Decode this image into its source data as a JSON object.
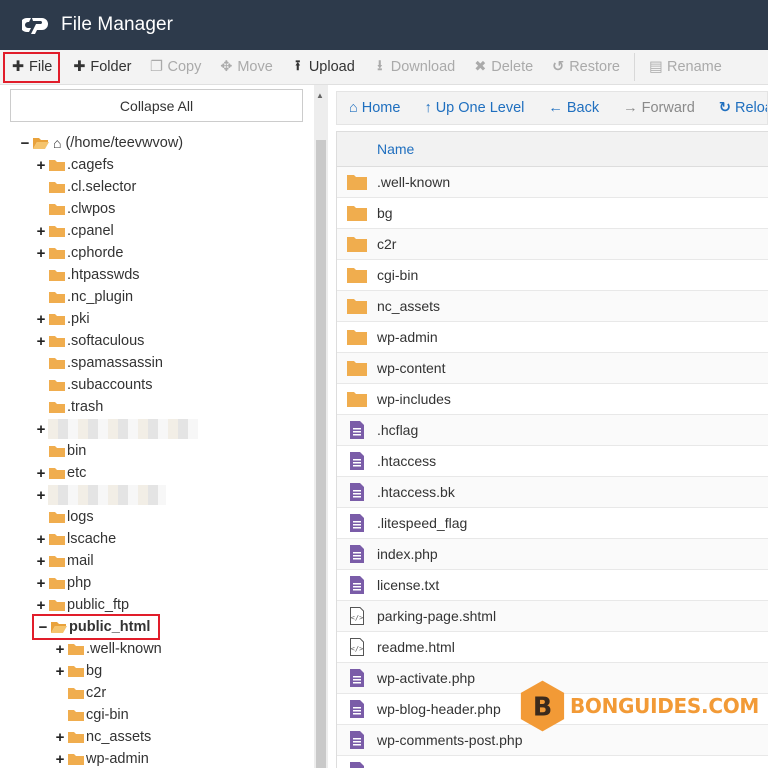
{
  "app": {
    "title": "File Manager",
    "logo": "cp-logo"
  },
  "toolbar": {
    "items": [
      {
        "label": "File",
        "icon": "plus-icon",
        "enabled": true
      },
      {
        "label": "Folder",
        "icon": "plus-icon",
        "enabled": true
      },
      {
        "label": "Copy",
        "icon": "copy-icon",
        "enabled": false
      },
      {
        "label": "Move",
        "icon": "move-icon",
        "enabled": false
      },
      {
        "label": "Upload",
        "icon": "upload-icon",
        "enabled": true
      },
      {
        "label": "Download",
        "icon": "download-icon",
        "enabled": false
      },
      {
        "label": "Delete",
        "icon": "delete-icon",
        "enabled": false
      },
      {
        "label": "Restore",
        "icon": "restore-icon",
        "enabled": false
      },
      {
        "label": "Rename",
        "icon": "rename-icon",
        "enabled": false
      }
    ]
  },
  "tree": {
    "collapse_label": "Collapse All",
    "root": "(/home/teevwvow)",
    "items": [
      {
        "name": ".cagefs",
        "expandable": true
      },
      {
        "name": ".cl.selector",
        "expandable": false
      },
      {
        "name": ".clwpos",
        "expandable": false
      },
      {
        "name": ".cpanel",
        "expandable": true
      },
      {
        "name": ".cphorde",
        "expandable": true
      },
      {
        "name": ".htpasswds",
        "expandable": false
      },
      {
        "name": ".nc_plugin",
        "expandable": false
      },
      {
        "name": ".pki",
        "expandable": true
      },
      {
        "name": ".softaculous",
        "expandable": true
      },
      {
        "name": ".spamassassin",
        "expandable": false
      },
      {
        "name": ".subaccounts",
        "expandable": false
      },
      {
        "name": ".trash",
        "expandable": false
      },
      {
        "name": "",
        "expandable": true,
        "redacted": true
      },
      {
        "name": "bin",
        "expandable": false
      },
      {
        "name": "etc",
        "expandable": true
      },
      {
        "name": "",
        "expandable": true,
        "redacted": true
      },
      {
        "name": "logs",
        "expandable": false
      },
      {
        "name": "lscache",
        "expandable": true
      },
      {
        "name": "mail",
        "expandable": true
      },
      {
        "name": "php",
        "expandable": true
      },
      {
        "name": "public_ftp",
        "expandable": true
      },
      {
        "name": "public_html",
        "expandable": true,
        "expanded": true,
        "selected": true
      }
    ],
    "children": [
      {
        "name": ".well-known",
        "expandable": true
      },
      {
        "name": "bg",
        "expandable": true
      },
      {
        "name": "c2r",
        "expandable": false
      },
      {
        "name": "cgi-bin",
        "expandable": false
      },
      {
        "name": "nc_assets",
        "expandable": true
      },
      {
        "name": "wp-admin",
        "expandable": true
      }
    ]
  },
  "nav": {
    "items": [
      {
        "label": "Home",
        "icon": "home-icon",
        "enabled": true
      },
      {
        "label": "Up One Level",
        "icon": "up-arrow-icon",
        "enabled": true
      },
      {
        "label": "Back",
        "icon": "left-arrow-icon",
        "enabled": true
      },
      {
        "label": "Forward",
        "icon": "right-arrow-icon",
        "enabled": false
      },
      {
        "label": "Reload",
        "icon": "reload-icon",
        "enabled": true
      }
    ]
  },
  "files": {
    "header": "Name",
    "rows": [
      {
        "name": ".well-known",
        "type": "folder"
      },
      {
        "name": "bg",
        "type": "folder"
      },
      {
        "name": "c2r",
        "type": "folder"
      },
      {
        "name": "cgi-bin",
        "type": "folder"
      },
      {
        "name": "nc_assets",
        "type": "folder"
      },
      {
        "name": "wp-admin",
        "type": "folder"
      },
      {
        "name": "wp-content",
        "type": "folder"
      },
      {
        "name": "wp-includes",
        "type": "folder"
      },
      {
        "name": ".hcflag",
        "type": "file"
      },
      {
        "name": ".htaccess",
        "type": "file"
      },
      {
        "name": ".htaccess.bk",
        "type": "file"
      },
      {
        "name": ".litespeed_flag",
        "type": "file"
      },
      {
        "name": "index.php",
        "type": "file"
      },
      {
        "name": "license.txt",
        "type": "file"
      },
      {
        "name": "parking-page.shtml",
        "type": "code"
      },
      {
        "name": "readme.html",
        "type": "code"
      },
      {
        "name": "wp-activate.php",
        "type": "file"
      },
      {
        "name": "wp-blog-header.php",
        "type": "file"
      },
      {
        "name": "wp-comments-post.php",
        "type": "file"
      },
      {
        "name": "",
        "type": "file"
      }
    ]
  },
  "watermark": {
    "text": "BONGUIDES.COM",
    "letter": "B"
  },
  "colors": {
    "header_bg": "#2d3a4b",
    "folder": "#f0ad4e",
    "file": "#7a5ca8",
    "link": "#1f6fbf",
    "highlight": "#e11d2a"
  }
}
